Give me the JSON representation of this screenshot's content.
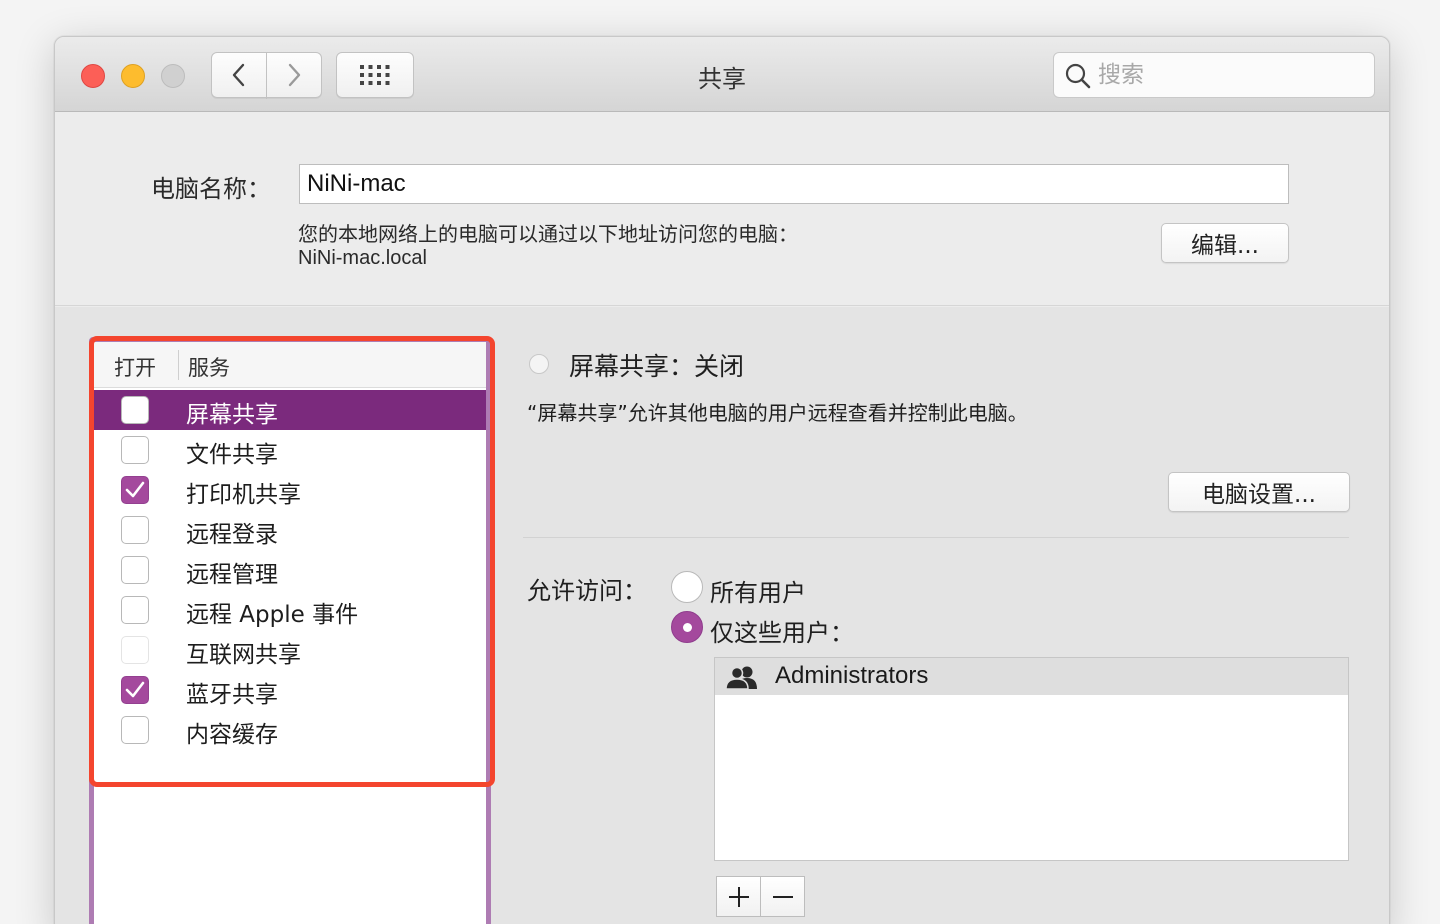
{
  "window": {
    "title": "共享"
  },
  "search": {
    "placeholder": "搜索"
  },
  "computer": {
    "name_label": "电脑名称：",
    "name_value": "NiNi-mac",
    "description": "您的本地网络上的电脑可以通过以下地址访问您的电脑：",
    "local_address": "NiNi-mac.local",
    "edit_label": "编辑..."
  },
  "services": {
    "header_on": "打开",
    "header_service": "服务",
    "items": [
      {
        "label": "屏幕共享",
        "checked": false,
        "selected": true
      },
      {
        "label": "文件共享",
        "checked": false
      },
      {
        "label": "打印机共享",
        "checked": true
      },
      {
        "label": "远程登录",
        "checked": false
      },
      {
        "label": "远程管理",
        "checked": false
      },
      {
        "label": "远程 Apple 事件",
        "checked": false
      },
      {
        "label": "互联网共享",
        "checked": false,
        "disabled": true
      },
      {
        "label": "蓝牙共享",
        "checked": true
      },
      {
        "label": "内容缓存",
        "checked": false
      }
    ]
  },
  "detail": {
    "status_title": "屏幕共享：关闭",
    "status_desc": "“屏幕共享”允许其他电脑的用户远程查看并控制此电脑。",
    "computer_settings_label": "电脑设置...",
    "access_label": "允许访问：",
    "option_all": "所有用户",
    "option_only": "仅这些用户：",
    "selected_option": "仅这些用户：",
    "users": [
      "Administrators"
    ],
    "add_label": "+",
    "remove_label": "−"
  },
  "colors": {
    "accent": "#a4499d",
    "selection": "#7b2a7d",
    "highlight_frame": "#f4452e"
  }
}
